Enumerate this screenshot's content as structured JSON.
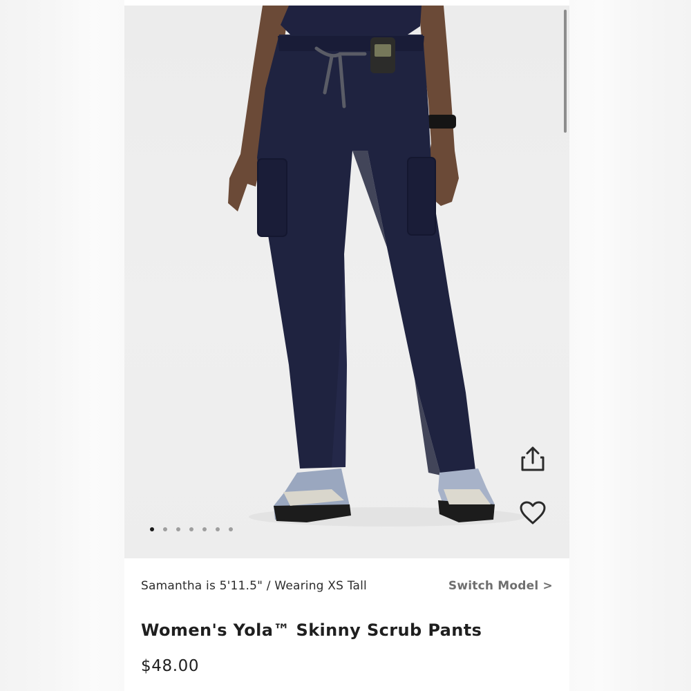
{
  "model_info": {
    "text": "Samantha is 5'11.5\" / Wearing XS Tall",
    "switch_label": "Switch Model >"
  },
  "product": {
    "title": "Women's Yola™ Skinny Scrub Pants",
    "price": "$48.00"
  },
  "gallery": {
    "image_count": 7,
    "active_index": 0
  },
  "icons": {
    "share": "share-icon",
    "favorite": "heart-icon"
  },
  "colors": {
    "pants_navy": "#1f2340",
    "background": "#ececec",
    "text_dark": "#1f1f1f",
    "link_gray": "#6f6f6f"
  }
}
